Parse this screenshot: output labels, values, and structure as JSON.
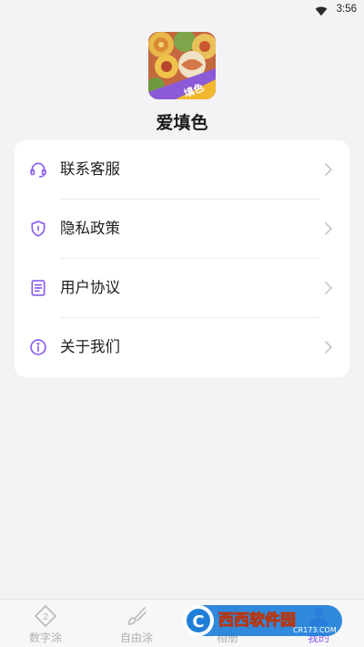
{
  "status_bar": {
    "time": "3:56",
    "icons": [
      "wifi-icon"
    ]
  },
  "profile": {
    "app_name": "爱填色",
    "logo_badge": "填色"
  },
  "menu": {
    "items": [
      {
        "label": "联系客服",
        "icon": "headset-icon"
      },
      {
        "label": "隐私政策",
        "icon": "shield-icon"
      },
      {
        "label": "用户协议",
        "icon": "document-icon"
      },
      {
        "label": "关于我们",
        "icon": "info-icon"
      }
    ]
  },
  "tabbar": {
    "tabs": [
      {
        "label": "数字涂",
        "icon": "number-paint-icon",
        "active": false
      },
      {
        "label": "自由涂",
        "icon": "brush-icon",
        "active": false
      },
      {
        "label": "相册",
        "icon": "album-icon",
        "active": false
      },
      {
        "label": "我的",
        "icon": "profile-icon",
        "active": true
      }
    ]
  },
  "watermark": {
    "brand": "西西软件园",
    "url": "CR173.COM"
  },
  "colors": {
    "accent": "#8a5cf0",
    "background": "#f3f3f5",
    "card": "#ffffff"
  }
}
